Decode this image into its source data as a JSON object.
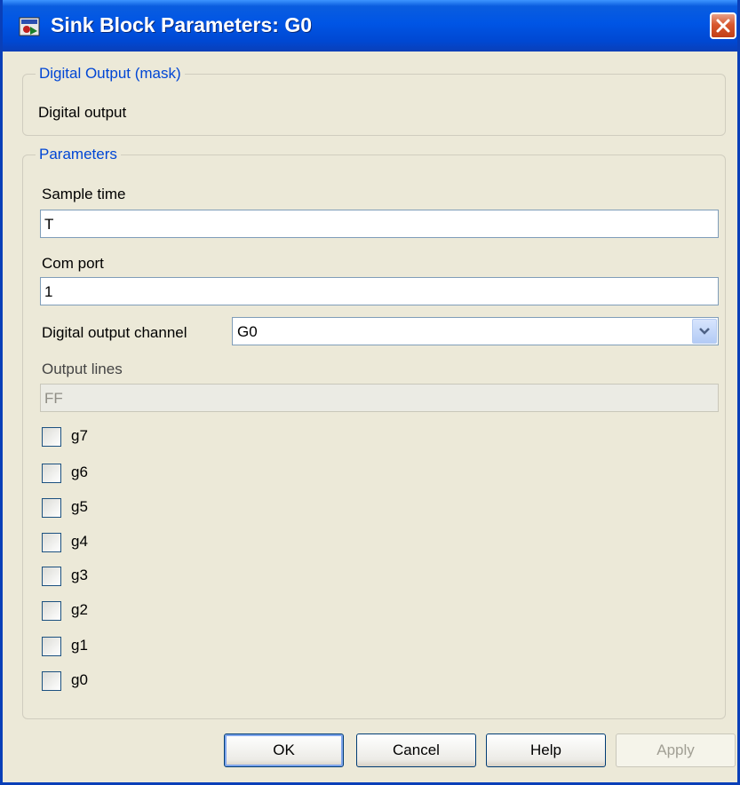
{
  "window": {
    "title": "Sink Block Parameters: G0"
  },
  "mask_group": {
    "legend": "Digital Output (mask)",
    "description": "Digital output"
  },
  "params_group": {
    "legend": "Parameters",
    "sample_time": {
      "label": "Sample time",
      "value": "T"
    },
    "com_port": {
      "label": "Com port",
      "value": "1"
    },
    "channel": {
      "label": "Digital output channel",
      "value": "G0"
    },
    "output_lines": {
      "label": "Output lines",
      "value": "FF"
    },
    "checkboxes": [
      {
        "label": "g7",
        "checked": false
      },
      {
        "label": "g6",
        "checked": false
      },
      {
        "label": "g5",
        "checked": false
      },
      {
        "label": "g4",
        "checked": false
      },
      {
        "label": "g3",
        "checked": false
      },
      {
        "label": "g2",
        "checked": false
      },
      {
        "label": "g1",
        "checked": false
      },
      {
        "label": "g0",
        "checked": false
      }
    ]
  },
  "buttons": {
    "ok": "OK",
    "cancel": "Cancel",
    "help": "Help",
    "apply": "Apply"
  },
  "icons": {
    "app": "simulink-block-icon",
    "close": "close-icon",
    "dropdown": "chevron-down-icon"
  }
}
